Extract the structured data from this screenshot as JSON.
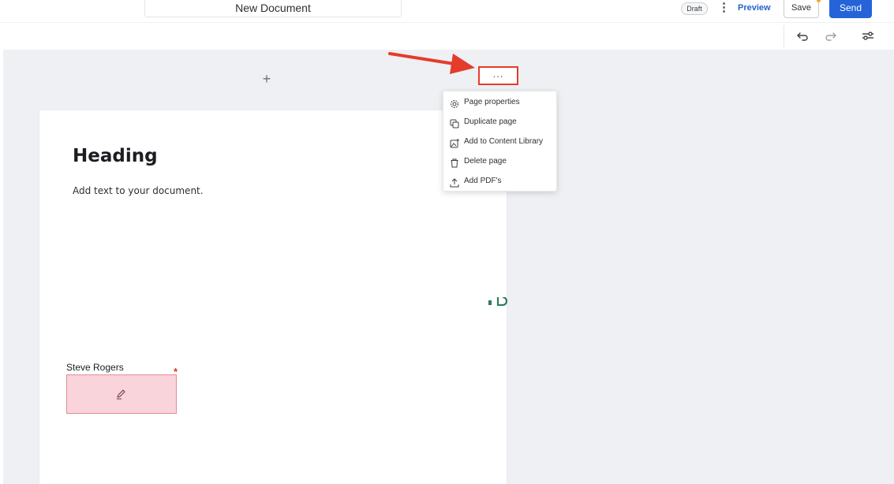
{
  "header": {
    "doc_title": "New Document",
    "status_badge": "Draft",
    "more_glyph": "⋮",
    "preview_label": "Preview",
    "save_label": "Save",
    "send_label": "Send"
  },
  "toolbar": {
    "icons": [
      "undo-icon",
      "redo-icon",
      "settings-sliders-icon"
    ]
  },
  "canvas": {
    "add_page_glyph": "+",
    "page_menu_glyph": "..."
  },
  "page": {
    "heading": "Heading",
    "body_text": "Add text to your document.",
    "signer_name": "Steve Rogers",
    "required_marker": "*"
  },
  "page_menu": {
    "items": [
      {
        "label": "Page properties",
        "icon": "gear-icon"
      },
      {
        "label": "Duplicate page",
        "icon": "duplicate-icon"
      },
      {
        "label": "Add to Content Library",
        "icon": "library-add-icon"
      },
      {
        "label": "Delete page",
        "icon": "trash-icon"
      },
      {
        "label": "Add PDF's",
        "icon": "upload-icon"
      }
    ]
  },
  "colors": {
    "accent_blue": "#2563d9",
    "annotation_red": "#e53b2b",
    "signature_fill": "#f9d4da"
  }
}
